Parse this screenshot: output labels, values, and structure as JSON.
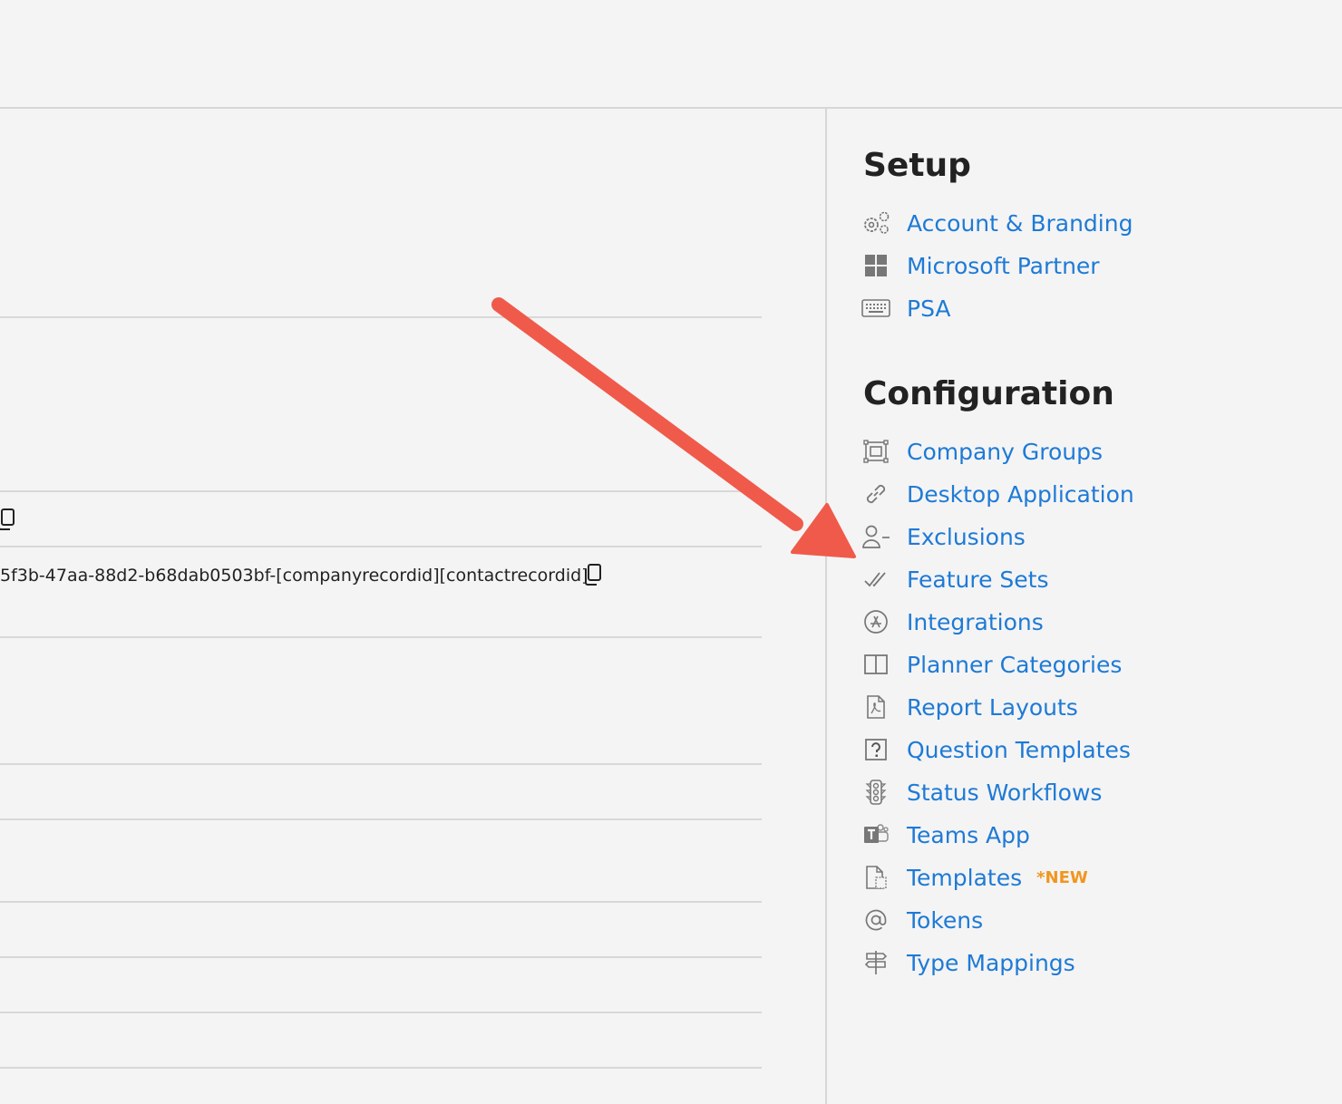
{
  "main": {
    "token_string": "5f3b-47aa-88d2-b68dab0503bf-[companyrecordid][contactrecordid]"
  },
  "sidebar": {
    "setup": {
      "title": "Setup",
      "items": [
        {
          "label": "Account & Branding",
          "icon": "gears-icon"
        },
        {
          "label": "Microsoft Partner",
          "icon": "windows-icon"
        },
        {
          "label": "PSA",
          "icon": "keyboard-icon"
        }
      ]
    },
    "configuration": {
      "title": "Configuration",
      "items": [
        {
          "label": "Company Groups",
          "icon": "group-icon"
        },
        {
          "label": "Desktop Application",
          "icon": "link-icon"
        },
        {
          "label": "Exclusions",
          "icon": "user-minus-icon"
        },
        {
          "label": "Feature Sets",
          "icon": "double-check-icon"
        },
        {
          "label": "Integrations",
          "icon": "app-store-icon"
        },
        {
          "label": "Planner Categories",
          "icon": "columns-icon"
        },
        {
          "label": "Report Layouts",
          "icon": "pdf-icon"
        },
        {
          "label": "Question Templates",
          "icon": "question-icon"
        },
        {
          "label": "Status Workflows",
          "icon": "traffic-light-icon"
        },
        {
          "label": "Teams App",
          "icon": "teams-icon"
        },
        {
          "label": "Templates",
          "icon": "template-icon",
          "badge": "*NEW"
        },
        {
          "label": "Tokens",
          "icon": "at-icon"
        },
        {
          "label": "Type Mappings",
          "icon": "signpost-icon"
        }
      ]
    }
  },
  "colors": {
    "link": "#1e7ad6",
    "badge": "#f0961e",
    "annotation_arrow": "#f05a4a"
  }
}
